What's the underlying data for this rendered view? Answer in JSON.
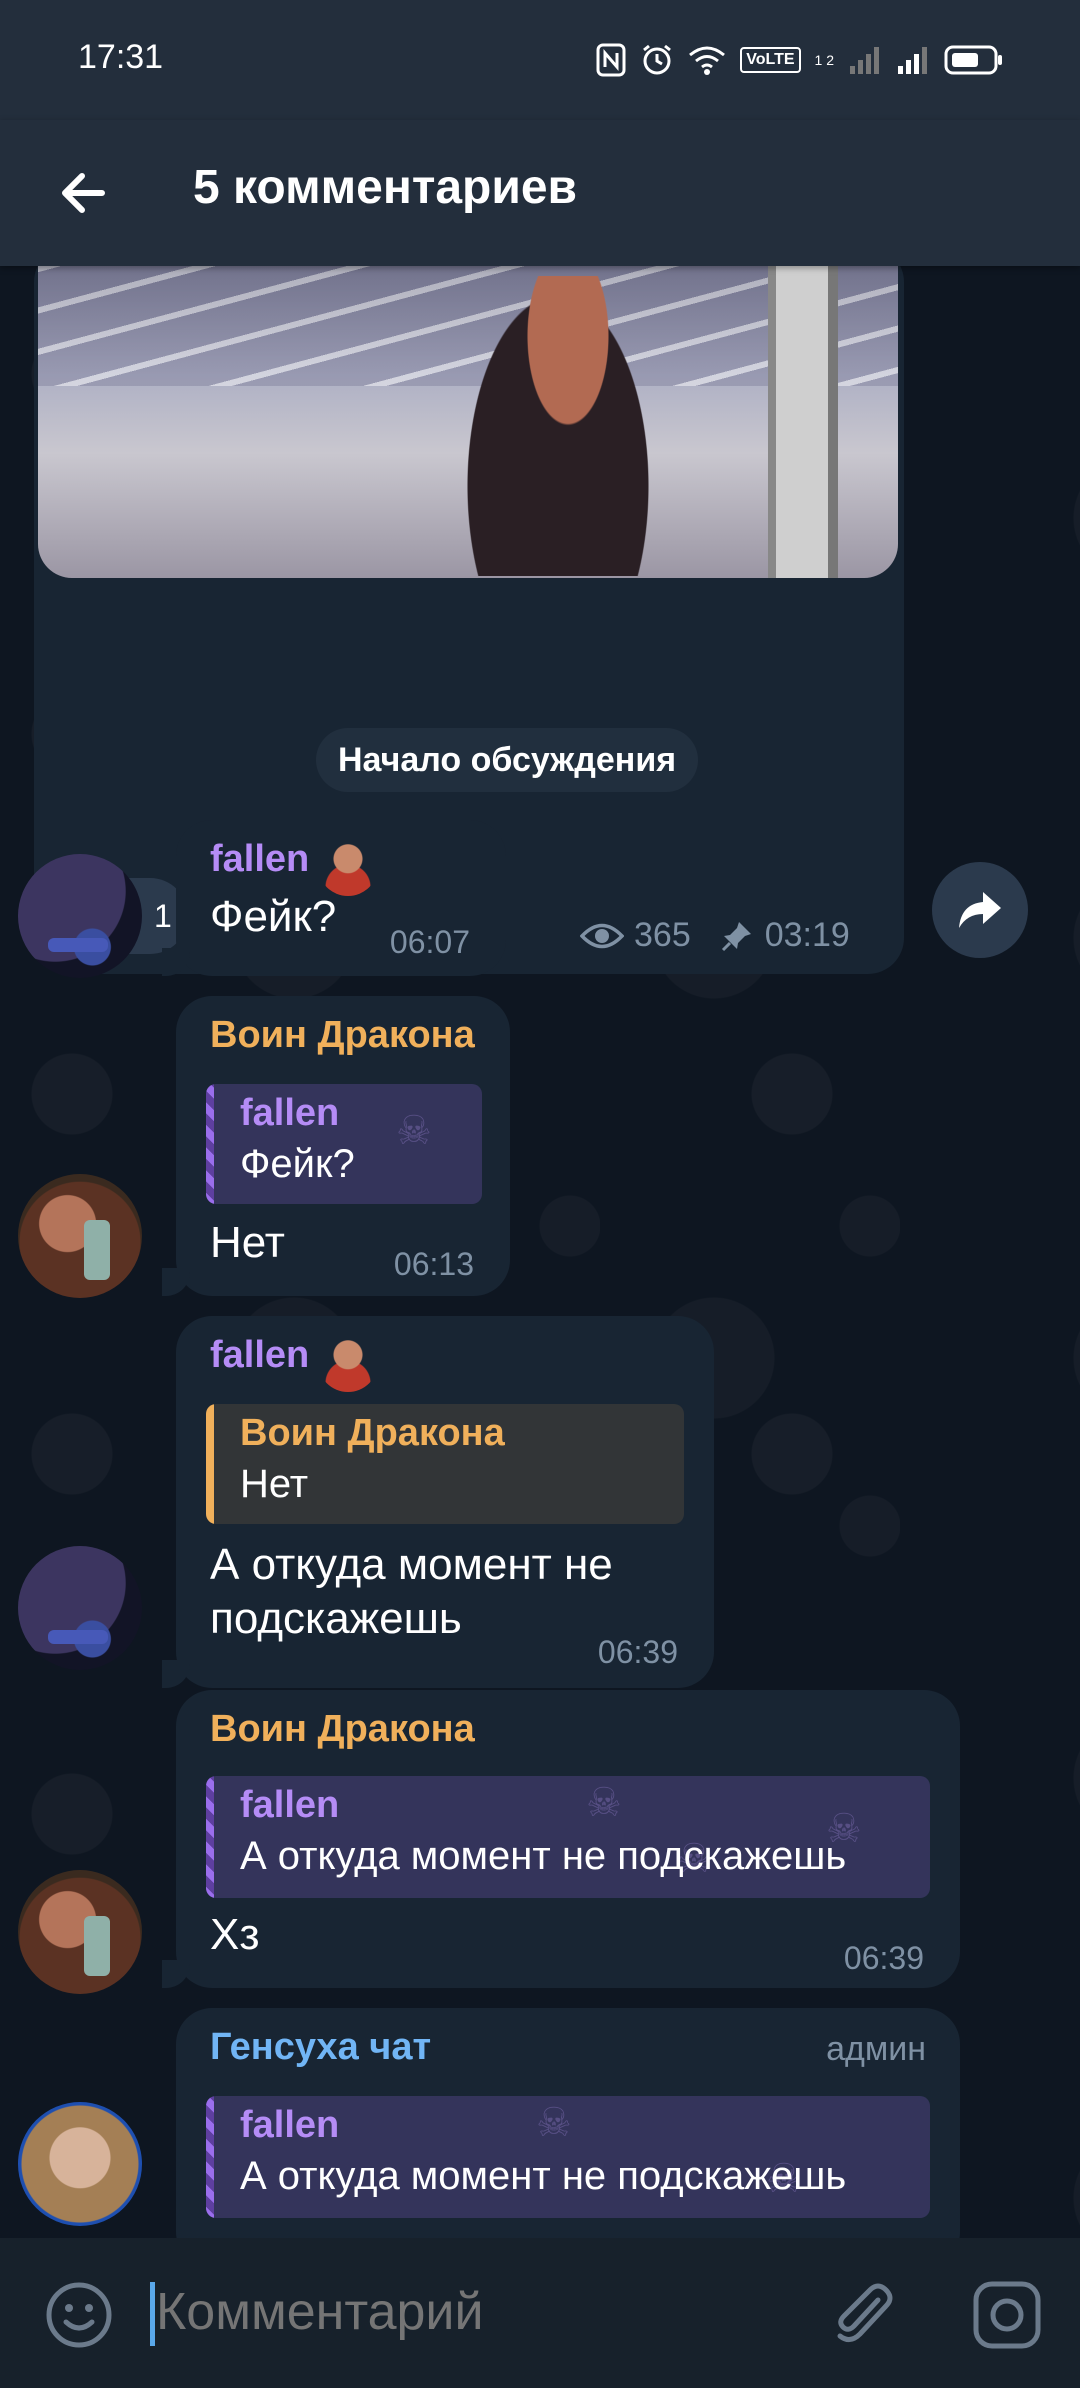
{
  "status_bar": {
    "time": "17:31",
    "network_badge": "VoLTE",
    "sim_indicator": "1 2"
  },
  "header": {
    "title": "5 комментариев"
  },
  "post": {
    "reaction": {
      "emoji": "🤯",
      "count": "1"
    },
    "views": "365",
    "time": "03:19"
  },
  "chat": {
    "date_pill": "Начало обсуждения",
    "messages": [
      {
        "sender": "fallen",
        "text": "Фейк?",
        "time": "06:07"
      },
      {
        "sender": "Воин Дракона",
        "reply_to": {
          "sender": "fallen",
          "text": "Фейк?"
        },
        "text": "Нет",
        "time": "06:13"
      },
      {
        "sender": "fallen",
        "reply_to": {
          "sender": "Воин Дракона",
          "text": "Нет"
        },
        "text_line1": "А откуда момент не",
        "text_line2": "подскажешь",
        "time": "06:39"
      },
      {
        "sender": "Воин Дракона",
        "reply_to": {
          "sender": "fallen",
          "text": "А откуда момент не подскажешь"
        },
        "text": "Хз",
        "time": "06:39"
      },
      {
        "sender": "Генсуха чат",
        "badge": "админ",
        "reply_to": {
          "sender": "fallen",
          "text": "А откуда момент не подскажешь"
        }
      }
    ]
  },
  "composer": {
    "placeholder": "Комментарий"
  },
  "colors": {
    "background": "#0e1621",
    "bubble": "#182533",
    "header": "#232e3c",
    "accent_purple": "#b58cf6",
    "accent_orange": "#f0b05b",
    "accent_blue": "#71b5f5",
    "meta_gray": "#7f91a4"
  }
}
